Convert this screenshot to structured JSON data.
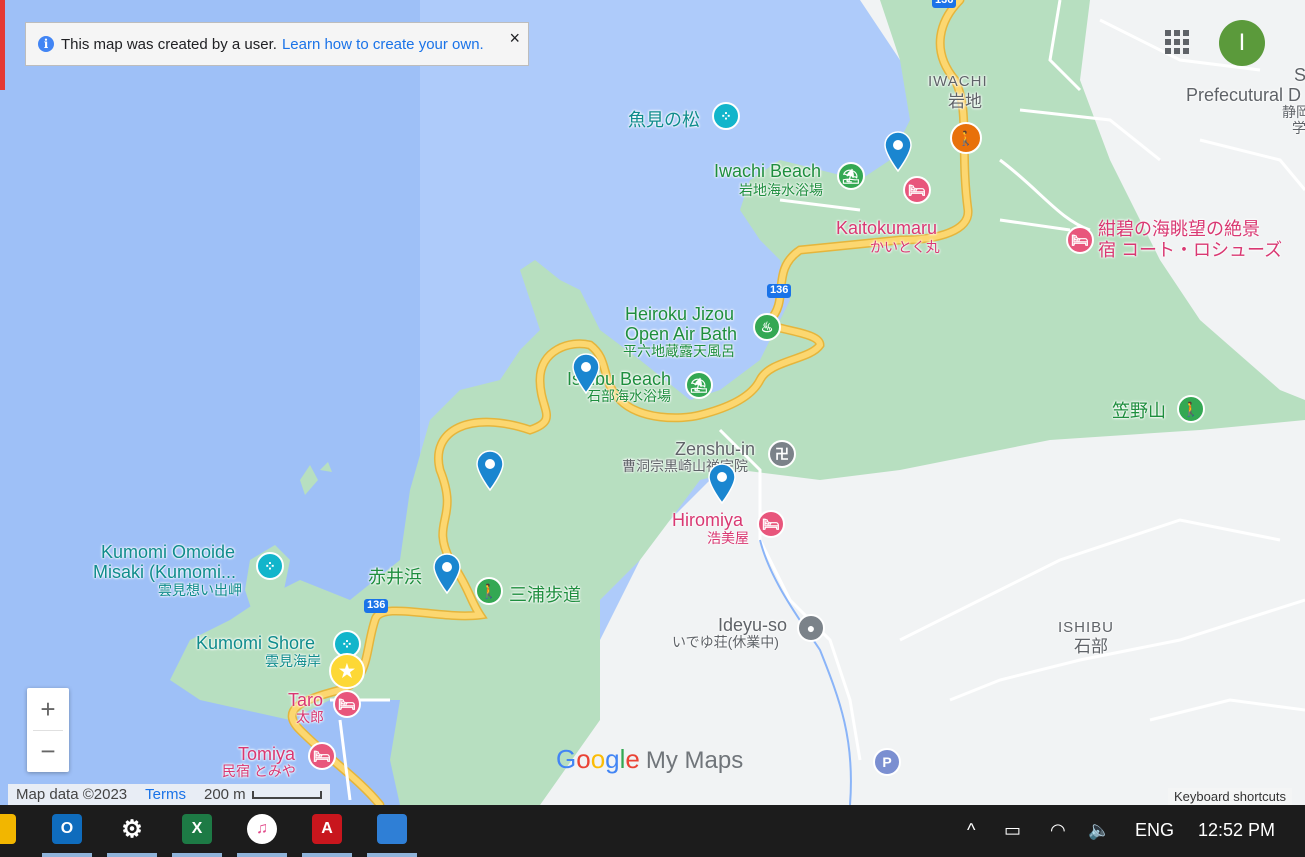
{
  "notice": {
    "text": "This map was created by a user.",
    "link": "Learn how to create your own.",
    "close": "×",
    "info_icon": "i"
  },
  "header": {
    "avatar_letter": "I"
  },
  "map": {
    "colors": {
      "water": "#aecbfa",
      "land": "#b7dfc0",
      "urban": "#f1f3f4",
      "road_major": "#f7c948",
      "accent": "#1a73e8"
    },
    "area_labels": [
      {
        "en": "IWACHI",
        "jp": "岩地"
      },
      {
        "en": "ISHIBU",
        "jp": "石部"
      }
    ],
    "places": {
      "uomi": "魚見の松",
      "iwachi_beach": "Iwachi Beach",
      "iwachi_beach_jp": "岩地海水浴場",
      "kaitokumaru": "Kaitokumaru",
      "kaitokumaru_jp": "かいとく丸",
      "konpeki_1": "紺碧の海眺望の絶景",
      "konpeki_2": "宿 コート・ロシューズ",
      "prefectural_1": "Prefecutural D",
      "prefectural_2": "静岡",
      "prefectural_3": "学",
      "s_label": "S",
      "heiroku_1": "Heiroku Jizou",
      "heiroku_2": "Open Air Bath",
      "heiroku_jp": "平六地蔵露天風呂",
      "ishibu_beach": "Ishibu Beach",
      "ishibu_beach_jp": "石部海水浴場",
      "kasanoyama": "笠野山",
      "zenshu": "Zenshu-in",
      "zenshu_jp": "曹洞宗黒崎山禅宗院",
      "hiromiya": "Hiromiya",
      "hiromiya_jp": "浩美屋",
      "kumomi_omoide_1": "Kumomi Omoide",
      "kumomi_omoide_2": "Misaki (Kumomi...",
      "kumomi_omoide_jp": "雲見想い出岬",
      "akaihama": "赤井浜",
      "miura": "三浦歩道",
      "kumomi_shore": "Kumomi Shore",
      "kumomi_shore_jp": "雲見海岸",
      "taro": "Taro",
      "taro_jp": "太郎",
      "tomiya": "Tomiya",
      "tomiya_jp": "民宿 とみや",
      "ideyu": "Ideyu-so",
      "ideyu_jp": "いでゆ荘(休業中)"
    },
    "route_shields": [
      "136",
      "136",
      "136"
    ],
    "parking": "P"
  },
  "zoom": {
    "in": "+",
    "out": "−"
  },
  "footer": {
    "map_data": "Map data ©2023",
    "terms": "Terms",
    "scale": "200 m",
    "keyboard": "Keyboard shortcuts"
  },
  "brand": {
    "g": "G",
    "o1": "o",
    "o2": "o",
    "g2": "g",
    "l": "l",
    "e": "e",
    "my_maps": "My Maps"
  },
  "taskbar": {
    "apps": [
      {
        "icon": "file-explorer-icon",
        "glyph": ""
      },
      {
        "icon": "outlook-icon",
        "glyph": "O"
      },
      {
        "icon": "settings-gear-icon",
        "glyph": "⚙"
      },
      {
        "icon": "excel-icon",
        "glyph": "X"
      },
      {
        "icon": "itunes-icon",
        "glyph": "♫"
      },
      {
        "icon": "acrobat-icon",
        "glyph": "A"
      },
      {
        "icon": "photos-icon",
        "glyph": ""
      }
    ],
    "tray": {
      "chevron": "^",
      "lang": "ENG",
      "time": "12:52 PM"
    }
  }
}
